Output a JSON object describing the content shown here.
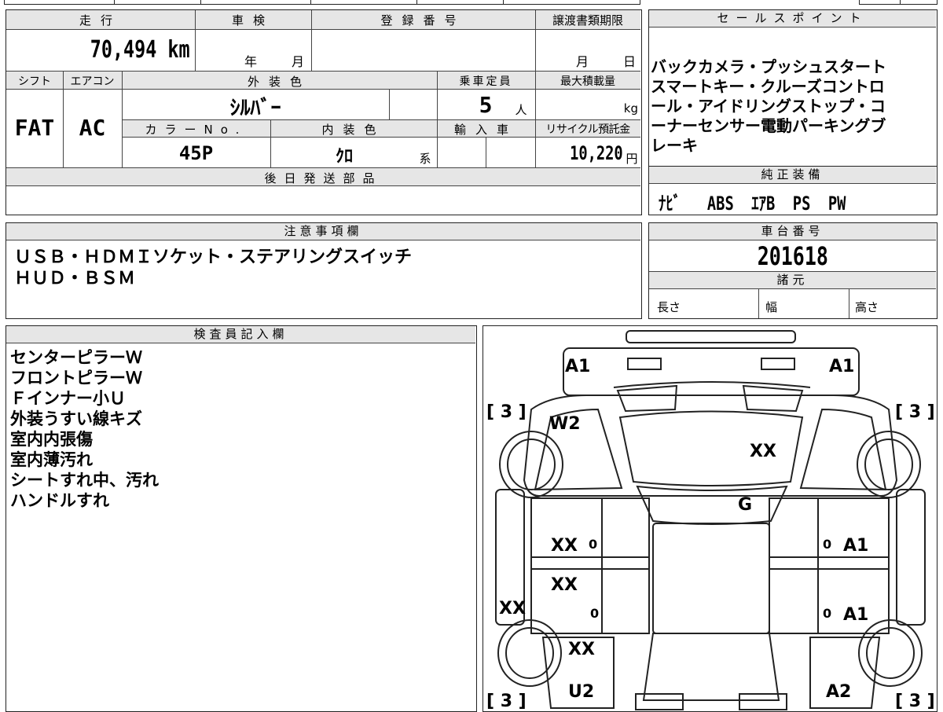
{
  "vehicle": {
    "mileage_label": "走行",
    "mileage_value": "70,494 km",
    "shaken_label": "車検",
    "shaken_year": "年",
    "shaken_month": "月",
    "registration_label": "登録番号",
    "transfer_deadline_label": "譲渡書類期限",
    "transfer_month": "月",
    "transfer_day": "日",
    "shift_label": "シフト",
    "shift_value": "FAT",
    "aircon_label": "エアコン",
    "aircon_value": "AC",
    "exterior_color_label": "外装色",
    "exterior_color_value": "ｼﾙﾊﾞｰ",
    "capacity_label": "乗車定員",
    "capacity_value": "5",
    "capacity_unit": "人",
    "max_load_label": "最大積載量",
    "max_load_unit": "kg",
    "color_no_label": "カラーNo.",
    "color_no_value": "45P",
    "interior_color_label": "内装色",
    "interior_color_value": "ｸﾛ",
    "interior_color_suffix": "系",
    "import_label": "輸入車",
    "recycle_label": "リサイクル預託金",
    "recycle_value": "10,220",
    "recycle_unit": "円",
    "later_parts_label": "後日発送部品"
  },
  "sales_point": {
    "label": "セールスポイント",
    "lines": [
      "バックカメラ・プッシュスタート",
      "スマートキー・クルーズコントロ",
      "ール・アイドリングストップ・コ",
      "ーナーセンサー電動パーキングブ",
      "レーキ"
    ]
  },
  "equipment": {
    "label": "純正装備",
    "items": [
      "ﾅﾋﾞ",
      "ABS",
      "ｴｱB",
      "PS",
      "PW"
    ]
  },
  "notes": {
    "label": "注意事項欄",
    "lines": [
      "ＵＳＢ・ＨＤＭＩソケット・ステアリングスイッチ",
      "ＨＵＤ・ＢＳＭ"
    ]
  },
  "chassis": {
    "label": "車台番号",
    "value": "201618"
  },
  "specs": {
    "label": "諸元",
    "length_label": "長さ",
    "width_label": "幅",
    "height_label": "高さ"
  },
  "inspector": {
    "label": "検査員記入欄",
    "lines": [
      "センターピラーＷ",
      "フロントピラーＷ",
      "Ｆインナー小Ｕ",
      "外装うすい線キズ",
      "室内内張傷",
      "室内薄汚れ",
      "シートすれ中、汚れ",
      "ハンドルすれ"
    ]
  },
  "diagram": {
    "marks": {
      "a1_front_left": "A1",
      "a1_front_right": "A1",
      "tire_fl": "[ 3 ]",
      "tire_fr": "[ 3 ]",
      "tire_rl": "[ 3 ]",
      "tire_rr": "[ 3 ]",
      "w2": "W2",
      "xx_hood": "XX",
      "g_windshield": "G",
      "xx_front_left_door": "XX",
      "zero_fl": "0",
      "a1_front_right_door": "A1",
      "zero_fr": "0",
      "xx_rear_left_door": "XX",
      "zero_rl": "0",
      "a1_rear_right_door": "A1",
      "zero_rr": "0",
      "xx_left_side": "XX",
      "xx_rear_left": "XX",
      "u2": "U2",
      "a2": "A2"
    }
  }
}
